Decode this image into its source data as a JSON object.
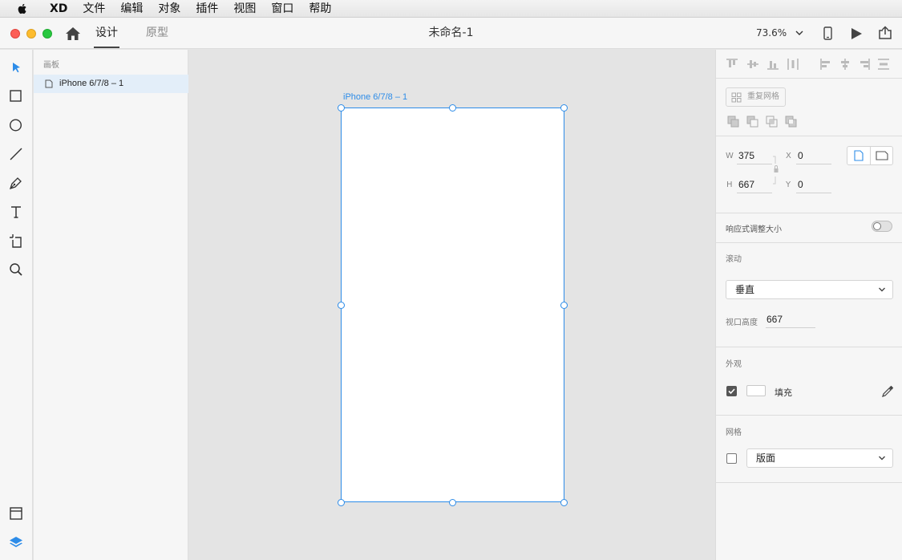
{
  "menubar": {
    "app": "XD",
    "items": [
      "文件",
      "编辑",
      "对象",
      "插件",
      "视图",
      "窗口",
      "帮助"
    ]
  },
  "titlebar": {
    "tabs": {
      "design": "设计",
      "prototype": "原型"
    },
    "document_title": "未命名-1",
    "zoom": "73.6%"
  },
  "layers": {
    "heading": "画板",
    "items": [
      {
        "label": "iPhone 6/7/8 – 1",
        "selected": true
      }
    ]
  },
  "canvas": {
    "artboard_label": "iPhone 6/7/8 – 1"
  },
  "inspector": {
    "repeat_grid": "重复网格",
    "size": {
      "w_label": "W",
      "w": "375",
      "h_label": "H",
      "h": "667",
      "x_label": "X",
      "x": "0",
      "y_label": "Y",
      "y": "0"
    },
    "responsive_resize": {
      "label": "响应式调整大小",
      "on": false
    },
    "scroll": {
      "title": "滚动",
      "value": "垂直",
      "viewport_label": "视口高度",
      "viewport_value": "667"
    },
    "appearance": {
      "title": "外观",
      "fill_label": "填充",
      "fill_checked": true,
      "fill_color": "#ffffff"
    },
    "grid": {
      "title": "网格",
      "checked": false,
      "value": "版面"
    }
  },
  "colors": {
    "accent": "#2d8ce8",
    "close": "#fc5f57",
    "minimize": "#fdbc2e",
    "zoom": "#28c840"
  }
}
